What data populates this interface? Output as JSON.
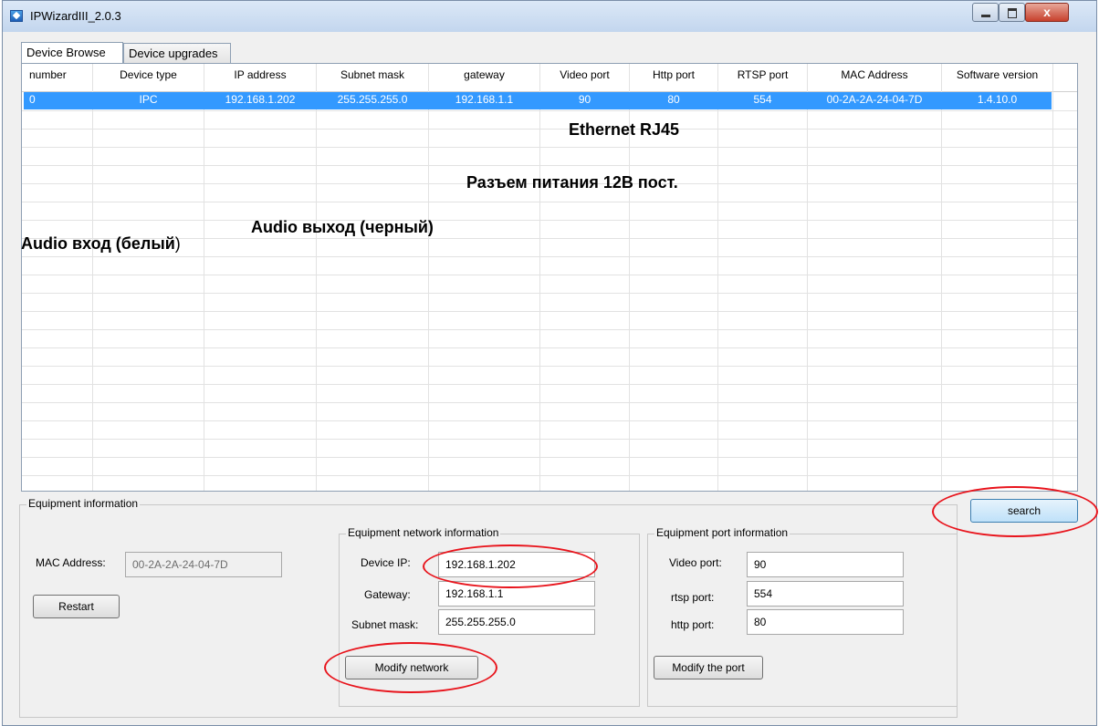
{
  "window": {
    "title": "IPWizardIII_2.0.3",
    "close_glyph": "x"
  },
  "tabs": {
    "browse": "Device Browse",
    "upgrades": "Device upgrades"
  },
  "table": {
    "headers": [
      "number",
      "Device type",
      "IP address",
      "Subnet mask",
      "gateway",
      "Video port",
      "Http port",
      "RTSP port",
      "MAC Address",
      "Software version"
    ],
    "row": [
      "0",
      "IPC",
      "192.168.1.202",
      "255.255.255.0",
      "192.168.1.1",
      "90",
      "80",
      "554",
      "00-2A-2A-24-04-7D",
      "1.4.10.0"
    ]
  },
  "annotations": {
    "ethernet": "Ethernet RJ45",
    "power": "Разъем питания 12В пост.",
    "audio_out": "Audio выход (черный)",
    "audio_in": "Audio вход (белый",
    "audio_in_paren": ")"
  },
  "equipment": {
    "title": "Equipment information",
    "mac_label": "MAC Address:",
    "mac_value": "00-2A-2A-24-04-7D",
    "restart": "Restart",
    "search": "search"
  },
  "network": {
    "title": "Equipment network information",
    "ip_label": "Device IP:",
    "ip_value": "192.168.1.202",
    "gateway_label": "Gateway:",
    "gateway_value": "192.168.1.1",
    "mask_label": "Subnet mask:",
    "mask_value": "255.255.255.0",
    "modify": "Modify network"
  },
  "ports": {
    "title": "Equipment port information",
    "video_label": "Video port:",
    "video_value": "90",
    "rtsp_label": "rtsp port:",
    "rtsp_value": "554",
    "http_label": "http port:",
    "http_value": "80",
    "modify": "Modify the port"
  },
  "colors": {
    "highlight": "#e8141c",
    "selection": "#3399ff"
  }
}
